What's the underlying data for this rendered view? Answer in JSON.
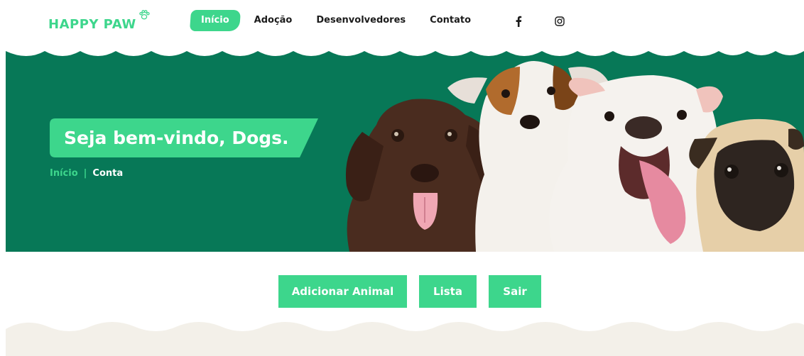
{
  "brand": {
    "name": "HAPPY PAW",
    "color": "#3dd68c"
  },
  "nav": {
    "items": [
      {
        "label": "Início",
        "active": true
      },
      {
        "label": "Adoção",
        "active": false
      },
      {
        "label": "Desenvolvedores",
        "active": false
      },
      {
        "label": "Contato",
        "active": false
      }
    ],
    "social": [
      "facebook-icon",
      "instagram-icon"
    ]
  },
  "hero": {
    "title": "Seja bem-vindo, Dogs.",
    "breadcrumb": {
      "home": "Início",
      "separator": "|",
      "current": "Conta"
    },
    "background": "#077857",
    "accent": "#3dd68c",
    "image": "dogs-group-photo"
  },
  "actions": {
    "add_label": "Adicionar Animal",
    "list_label": "Lista",
    "exit_label": "Sair"
  },
  "colors": {
    "primary": "#3dd68c",
    "dark_green": "#077857",
    "footer_wave": "#f3f0e9"
  }
}
